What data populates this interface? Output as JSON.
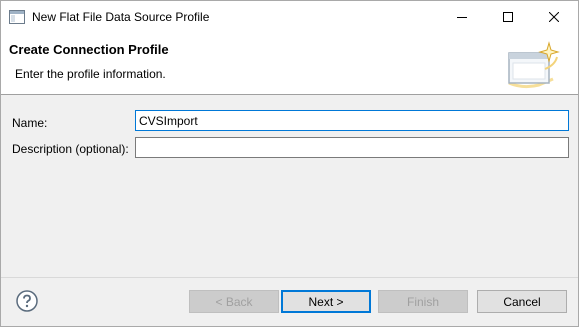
{
  "window": {
    "title": "New Flat File Data Source Profile",
    "controls": {
      "minimize_icon": "minimize-icon",
      "maximize_icon": "maximize-icon",
      "close_icon": "close-icon"
    }
  },
  "banner": {
    "title": "Create Connection Profile",
    "message": "Enter the profile information."
  },
  "form": {
    "name_label": "Name:",
    "name_value": "CVSImport",
    "description_label": "Description (optional):",
    "description_value": ""
  },
  "buttons": {
    "back": "< Back",
    "next": "Next >",
    "finish": "Finish",
    "cancel": "Cancel"
  },
  "colors": {
    "accent": "#0078d7",
    "help_icon": "#5a6b7d"
  }
}
